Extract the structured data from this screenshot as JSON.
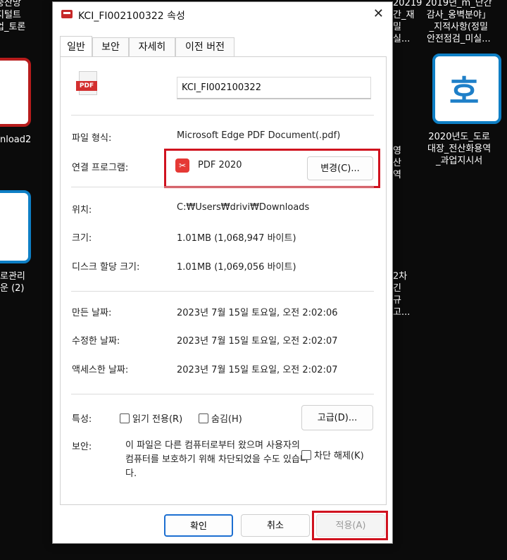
{
  "desktop": {
    "frag_left_top": "중산망\n지털트\n업_토론",
    "frag_left_mid": "nload2",
    "frag_left_low": "로관리\n운 (2)",
    "frag_mid_top": "20219\n간_재\n밀\n실...",
    "frag_mid_mid": "영\n산\n역",
    "frag_mid_low": "2차\n긴\n규\n고...",
    "frag_right_top": "2019년_m_단간\n감사_옹벽분야」\n_지적사항(정밀\n안전점검_미실...",
    "frag_right_mid": "2020년도_도로\n대장_전산화용역\n_과업지시서",
    "tile_hanja": "호"
  },
  "dialog": {
    "title": "KCI_FI002100322 속성",
    "close": "✕",
    "tabs": [
      "일반",
      "보안",
      "자세히",
      "이전 버전"
    ],
    "file_name": "KCI_FI002100322",
    "pdf_label": "PDF",
    "file_type_label": "파일 형식:",
    "file_type_value": "Microsoft Edge PDF Document(.pdf)",
    "open_with_label": "연결 프로그램:",
    "open_with_value": "PDF 2020",
    "change_button": "변경(C)...",
    "location_label": "위치:",
    "location_value": "C:₩Users₩drivi₩Downloads",
    "size_label": "크기:",
    "size_value": "1.01MB (1,068,947 바이트)",
    "disk_size_label": "디스크 할당 크기:",
    "disk_size_value": "1.01MB (1,069,056 바이트)",
    "created_label": "만든 날짜:",
    "created_value": "2023년 7월 15일 토요일, 오전 2:02:06",
    "modified_label": "수정한 날짜:",
    "modified_value": "2023년 7월 15일 토요일, 오전 2:02:07",
    "accessed_label": "액세스한 날짜:",
    "accessed_value": "2023년 7월 15일 토요일, 오전 2:02:07",
    "attributes_label": "특성:",
    "readonly_label": "읽기 전용(R)",
    "hidden_label": "숨김(H)",
    "advanced_button": "고급(D)...",
    "security_label": "보안:",
    "security_text": "이 파일은 다른 컴퓨터로부터 왔으며 사용자의 컴퓨터를 보호하기 위해 차단되었을 수도 있습니다.",
    "unblock_label": "차단 해제(K)",
    "ok_button": "확인",
    "cancel_button": "취소",
    "apply_button": "적용(A)"
  },
  "colors": {
    "highlight": "#d0121f",
    "pdf_red": "#d32f2f",
    "tile_blue": "#1e7fc8"
  }
}
